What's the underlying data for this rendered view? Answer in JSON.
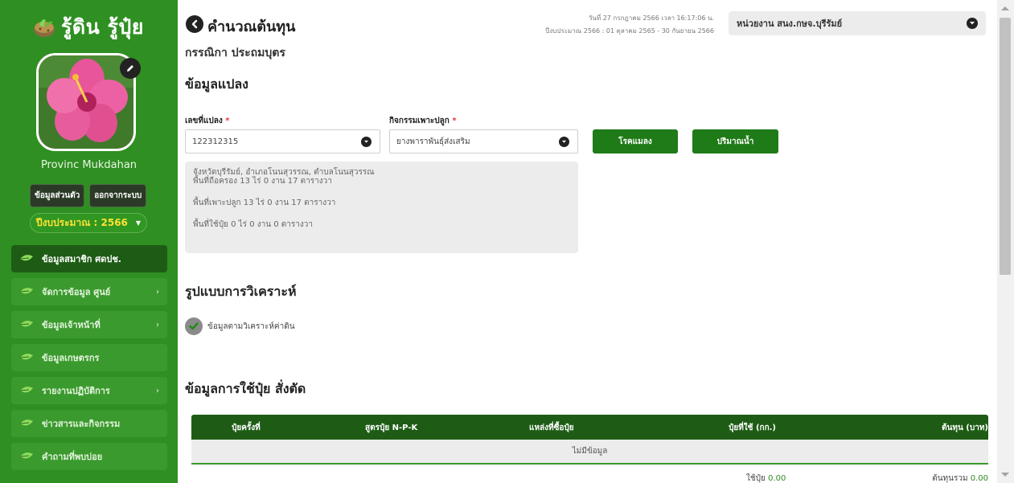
{
  "brand": {
    "title": "รู้ดิน รู้ปุ๋ย"
  },
  "user": {
    "name": "Provinc Mukdahan",
    "profile_btn": "ข้อมูลส่วนตัว",
    "logout_btn": "ออกจากระบบ"
  },
  "fiscal_year": {
    "label": "ปีงบประมาณ : 2566"
  },
  "sidebar": {
    "items": [
      {
        "label": "ข้อมูลสมาชิก ศดปช.",
        "has_sub": false
      },
      {
        "label": "จัดการข้อมูล ศูนย์",
        "has_sub": true
      },
      {
        "label": "ข้อมูลเจ้าหน้าที่",
        "has_sub": true
      },
      {
        "label": "ข้อมูลเกษตรกร",
        "has_sub": false
      },
      {
        "label": "รายงานปฏิบัติการ",
        "has_sub": true
      },
      {
        "label": "ข่าวสารและกิจกรรม",
        "has_sub": false
      },
      {
        "label": "คำถามที่พบบ่อย",
        "has_sub": false
      }
    ]
  },
  "header": {
    "title": "คำนวณต้นทุน",
    "datetime": "วันที่ 27 กรกฎาคม 2566 เวลา 16:17:06 น.",
    "fiscal_range": "ปีงบประมาณ 2566 : 01 ตุลาคม 2565 - 30 กันยายน 2566",
    "agency": "หน่วยงาน สนง.กษจ.บุรีรัมย์"
  },
  "person_name": "กรรณิกา ประถมบุตร",
  "plot": {
    "section_title": "ข้อมูลแปลง",
    "plot_no_label": "เลขที่แปลง",
    "plot_no_value": "122312315",
    "activity_label": "กิจกรรมเพาะปลูก",
    "activity_value": "ยางพาราพันธุ์ส่งเสริม",
    "req_mark": "*",
    "disease_btn": "โรคแมลง",
    "water_btn": "ปริมาณน้ำ",
    "info_location": "จังหวัดบุรีรัมย์, อำเภอโนนสุวรรณ, ตำบลโนนสุวรรณ",
    "info_area_own": "พื้นที่ถือครอง 13 ไร่ 0 งาน 17 ตารางวา",
    "info_area_plant": "พื้นที่เพาะปลูก 13 ไร่ 0 งาน 17 ตารางวา",
    "info_area_fert": "พื้นที่ใช้ปุ๋ย 0 ไร่ 0 งาน 0 ตารางวา"
  },
  "analysis": {
    "section_title": "รูปแบบการวิเคราะห์",
    "option_label": "ข้อมูลตามวิเคราะห์ค่าดิน"
  },
  "fert": {
    "section_title": "ข้อมูลการใช้ปุ๋ย สั่งตัด",
    "columns": [
      "ปุ๋ยครั้งที่",
      "สูตรปุ๋ย N-P-K",
      "แหล่งที่ซื้อปุ๋ย",
      "ปุ๋ยที่ใช้ (กก.)",
      "ต้นทุน (บาท)"
    ],
    "empty_text": "ไม่มีข้อมูล",
    "sum_fert_label": "ใช้ปุ๋ย",
    "sum_fert_value": "0.00",
    "sum_cost_label": "ต้นทุนรวม",
    "sum_cost_value": "0.00"
  },
  "colors": {
    "sidebar": "#2f8f22",
    "dark_green": "#1e5c15",
    "accent_yellow": "#ffe233"
  }
}
